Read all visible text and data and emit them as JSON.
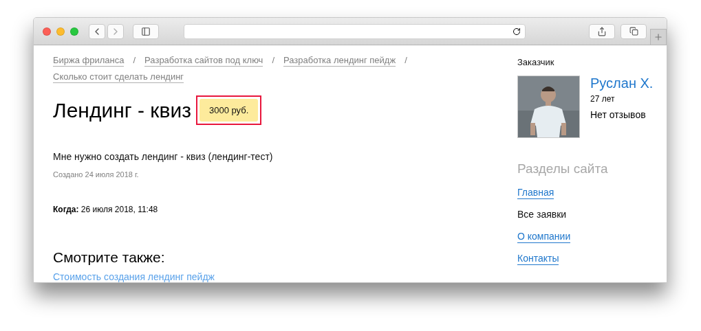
{
  "breadcrumbs": [
    {
      "label": "Биржа фриланса",
      "separator": "/"
    },
    {
      "label": "Разработка сайтов под ключ",
      "separator": "/"
    },
    {
      "label": "Разработка лендинг пейдж",
      "separator": "/"
    },
    {
      "label": "Сколько стоит сделать лендинг"
    }
  ],
  "title": "Лендинг - квиз",
  "price": "3000 руб.",
  "description": "Мне нужно создать лендинг - квиз (лендинг-тест)",
  "created": "Создано 24 июля 2018 г.",
  "when": {
    "label": "Когда:",
    "value": "26 июля 2018, 11:48"
  },
  "see_also": {
    "heading": "Смотрите также:",
    "links": [
      "Стоимость создания лендинг пейдж"
    ]
  },
  "customer": {
    "heading": "Заказчик",
    "name": "Руслан Х.",
    "age": "27 лет",
    "reviews": "Нет отзывов"
  },
  "site_sections": {
    "heading": "Разделы сайта",
    "items": [
      {
        "label": "Главная",
        "selected": false
      },
      {
        "label": "Все заявки",
        "selected": true
      },
      {
        "label": "О компании",
        "selected": false
      },
      {
        "label": "Контакты",
        "selected": false
      }
    ]
  }
}
